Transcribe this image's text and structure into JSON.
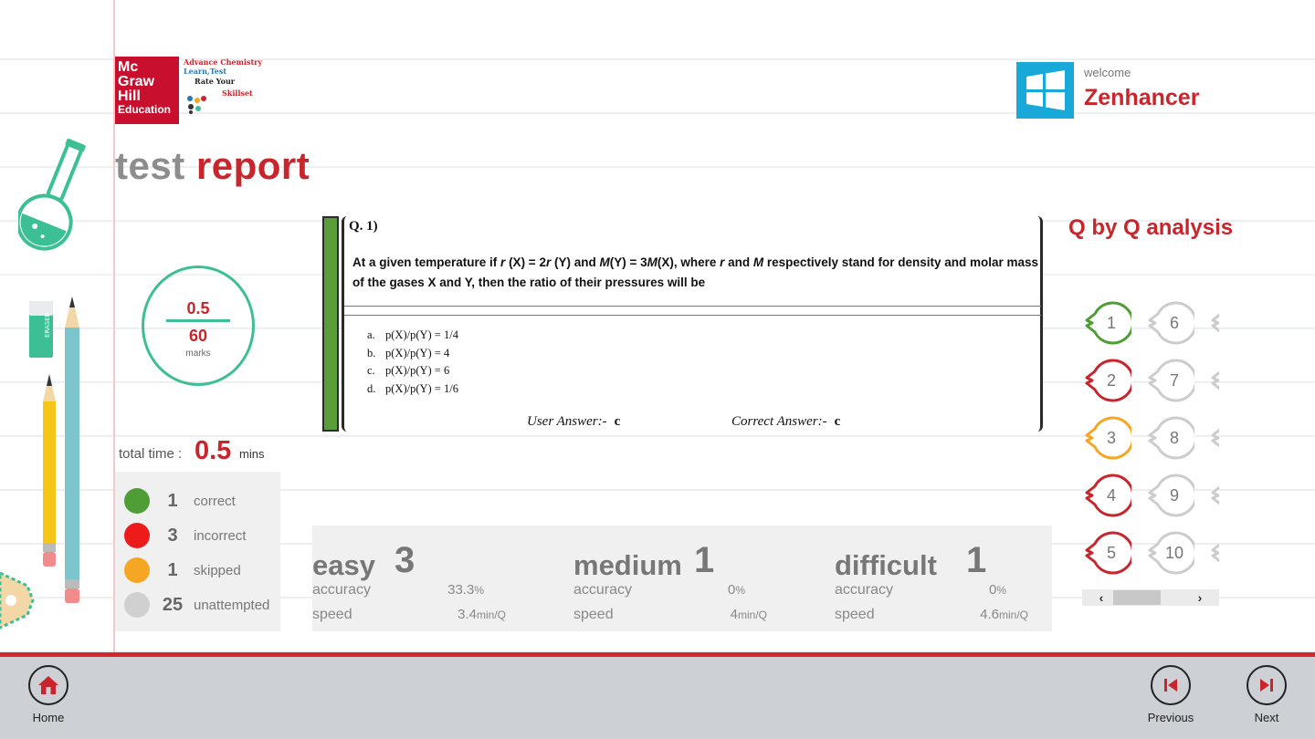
{
  "app": {
    "brand_line1": "Mc",
    "brand_line2": "Graw",
    "brand_line3": "Hill",
    "brand_line4": "Education",
    "tagline1": "Advance Chemistry",
    "tagline2": "Learn,Test",
    "tagline3": "Rate Your",
    "tagline4": "Skillset"
  },
  "header": {
    "title_part1": "test",
    "title_part2": "report"
  },
  "user": {
    "welcome": "welcome",
    "name": "Zenhancer"
  },
  "score": {
    "obtained": "0.5",
    "total": "60",
    "unit": "marks"
  },
  "total_time": {
    "label": "total time :",
    "value": "0.5",
    "unit": "mins"
  },
  "stats": [
    {
      "count": "1",
      "label": "correct",
      "color": "#4e9e35"
    },
    {
      "count": "3",
      "label": "incorrect",
      "color": "#ee1b1b"
    },
    {
      "count": "1",
      "label": "skipped",
      "color": "#f5a623"
    },
    {
      "count": "25",
      "label": "unattempted",
      "color": "#d0d0d0"
    }
  ],
  "question": {
    "number": "Q. 1)",
    "text_parts": [
      "At a given temperature if ",
      "r",
      " (X) = 2",
      "r",
      " (Y) and ",
      "M",
      "(Y) = 3",
      "M",
      "(X), where ",
      "r",
      " and ",
      "M",
      " respectively stand for density and molar mass of the gases X and Y, then the ratio of their pressures will be"
    ],
    "options": [
      {
        "key": "a.",
        "text": "p(X)/p(Y) = 1/4"
      },
      {
        "key": "b.",
        "text": "p(X)/p(Y) = 4"
      },
      {
        "key": "c.",
        "text": "p(X)/p(Y) = 6"
      },
      {
        "key": "d.",
        "text": "p(X)/p(Y) = 1/6"
      }
    ],
    "user_answer_label": "User Answer:-",
    "user_answer": "c",
    "correct_answer_label": "Correct Answer:-",
    "correct_answer": "c"
  },
  "difficulty": [
    {
      "name": "easy",
      "count": "3",
      "accuracy_label": "accuracy",
      "accuracy": "33.3",
      "accuracy_unit": "%",
      "speed_label": "speed",
      "speed": "3.4",
      "speed_unit": "min/Q"
    },
    {
      "name": "medium",
      "count": "1",
      "accuracy_label": "accuracy",
      "accuracy": "0",
      "accuracy_unit": "%",
      "speed_label": "speed",
      "speed": "4",
      "speed_unit": "min/Q"
    },
    {
      "name": "difficult",
      "count": "1",
      "accuracy_label": "accuracy",
      "accuracy": "0",
      "accuracy_unit": "%",
      "speed_label": "speed",
      "speed": "4.6",
      "speed_unit": "min/Q"
    }
  ],
  "qbyq": {
    "title": "Q by Q analysis",
    "items": [
      {
        "num": "1",
        "status": "correct",
        "color": "#4e9e35"
      },
      {
        "num": "2",
        "status": "incorrect",
        "color": "#c8252c"
      },
      {
        "num": "3",
        "status": "skipped",
        "color": "#f5a623"
      },
      {
        "num": "4",
        "status": "incorrect",
        "color": "#c8252c"
      },
      {
        "num": "5",
        "status": "incorrect",
        "color": "#c8252c"
      },
      {
        "num": "6",
        "status": "unattempted",
        "color": "#cccccc"
      },
      {
        "num": "7",
        "status": "unattempted",
        "color": "#cccccc"
      },
      {
        "num": "8",
        "status": "unattempted",
        "color": "#cccccc"
      },
      {
        "num": "9",
        "status": "unattempted",
        "color": "#cccccc"
      },
      {
        "num": "10",
        "status": "unattempted",
        "color": "#cccccc"
      }
    ],
    "scroll_left": "‹",
    "scroll_right": "›"
  },
  "bottom_bar": {
    "home": "Home",
    "previous": "Previous",
    "next": "Next"
  },
  "colors": {
    "accent": "#c8252c",
    "teal": "#3dbf96",
    "windows_tile": "#19a9d8",
    "question_bar": "#5a9e3a"
  }
}
